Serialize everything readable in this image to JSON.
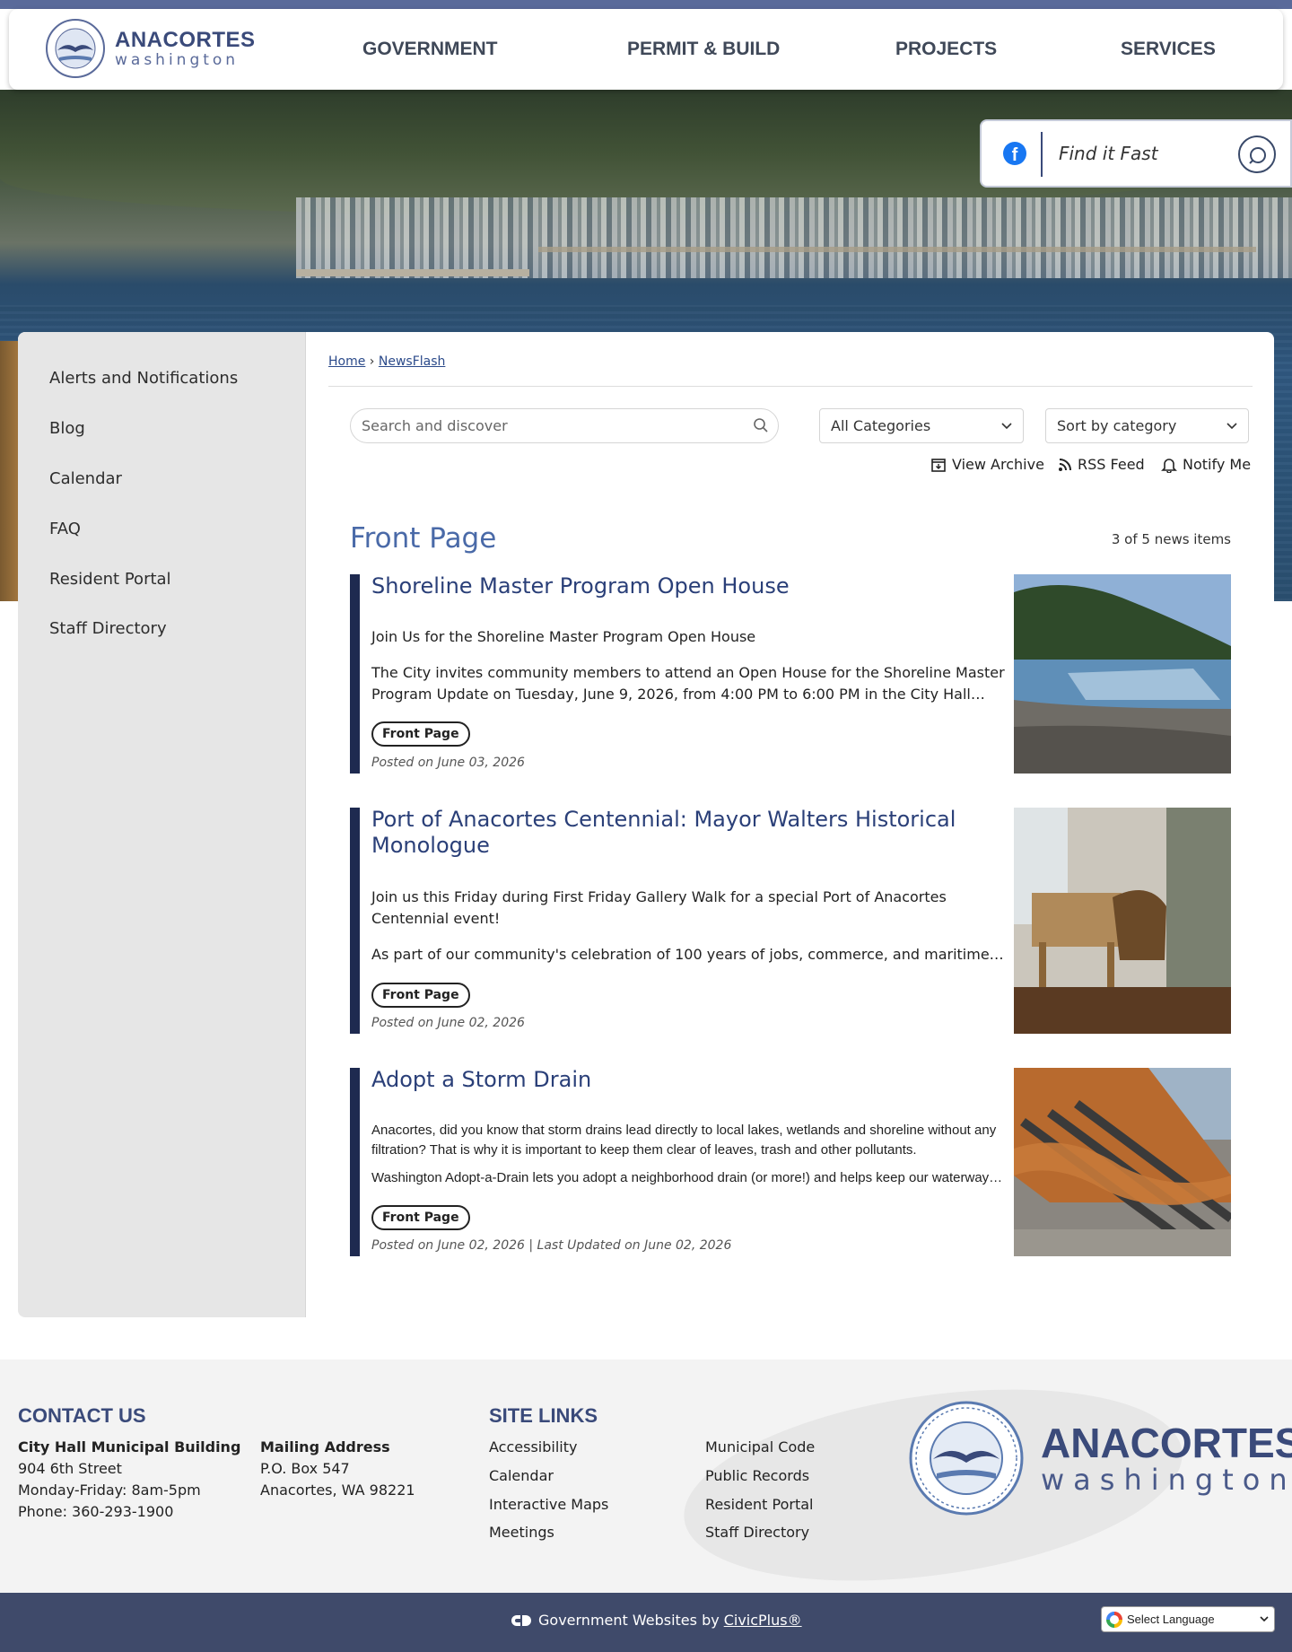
{
  "header": {
    "logo_main": "ANACORTES",
    "logo_sub": "washington",
    "nav": [
      "GOVERNMENT",
      "PERMIT & BUILD",
      "PROJECTS",
      "SERVICES"
    ]
  },
  "find": {
    "placeholder": "Find it Fast"
  },
  "sidebar": {
    "items": [
      "Alerts and Notifications",
      "Blog",
      "Calendar",
      "FAQ",
      "Resident Portal",
      "Staff Directory"
    ]
  },
  "breadcrumb": {
    "home": "Home",
    "separator": "›",
    "current": "NewsFlash"
  },
  "filters": {
    "search_placeholder": "Search and discover",
    "category": "All Categories",
    "sort": "Sort by category"
  },
  "tools": {
    "archive": "View Archive",
    "rss": "RSS Feed",
    "notify": "Notify Me"
  },
  "section": {
    "title": "Front Page",
    "count": "3 of 5 news items"
  },
  "news": [
    {
      "title": "Shoreline Master Program Open House",
      "p1": "Join Us for the Shoreline Master Program Open House",
      "p2": "The City invites community members to attend an Open House for the Shoreline Master Program Update on Tuesday, June 9, 2026, from 4:00 PM to 6:00 PM in the City Hall…",
      "tag": "Front Page",
      "meta": "Posted on June 03, 2026"
    },
    {
      "title": "Port of Anacortes Centennial: Mayor Walters Historical Monologue",
      "p1": "Join us this Friday during First Friday Gallery Walk for a special Port of Anacortes Centennial event!",
      "p2": "As part of our community's celebration of 100 years of jobs, commerce, and maritime…",
      "tag": "Front Page",
      "meta": "Posted on June 02, 2026"
    },
    {
      "title": "Adopt a Storm Drain",
      "p1": "Anacortes, did you know that storm drains lead directly to local lakes, wetlands and shoreline without any filtration? That is why it is important to keep them clear of leaves, trash and other pollutants.",
      "p2": "Washington Adopt-a-Drain lets you adopt a neighborhood drain (or more!) and helps keep our waterway…",
      "tag": "Front Page",
      "meta": "Posted on June 02, 2026 | Last Updated on June 02, 2026"
    }
  ],
  "footer": {
    "contact_heading": "CONTACT US",
    "city_hall": [
      "City Hall Municipal Building",
      "904 6th Street",
      "Monday-Friday: 8am-5pm",
      "Phone: 360-293-1900"
    ],
    "mailing": [
      "Mailing Address",
      "P.O. Box 547",
      "Anacortes, WA 98221"
    ],
    "links_heading": "SITE LINKS",
    "links_col1": [
      "Accessibility",
      "Calendar",
      "Interactive Maps",
      "Meetings"
    ],
    "links_col2": [
      "Municipal Code",
      "Public Records",
      "Resident Portal",
      "Staff Directory"
    ],
    "logo_main": "ANACORTES",
    "logo_sub": "washington"
  },
  "bottom": {
    "civic_text": "Government Websites by",
    "civic_link": "CivicPlus®",
    "language": "Select Language"
  },
  "colors": {
    "brand": "#3a4a7a",
    "accent_title": "#4a6aa8",
    "footer_bar": "#3f4a6a"
  }
}
